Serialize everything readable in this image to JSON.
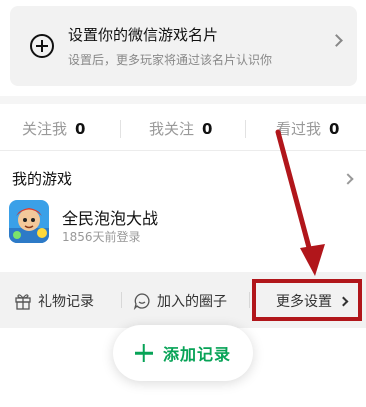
{
  "profile_card": {
    "title": "设置你的微信游戏名片",
    "subtitle": "设置后，更多玩家将通过该名片认识你"
  },
  "stats": [
    {
      "label": "关注我",
      "value": "0"
    },
    {
      "label": "我关注",
      "value": "0"
    },
    {
      "label": "看过我",
      "value": "0"
    }
  ],
  "games": {
    "title": "我的游戏",
    "items": [
      {
        "name": "全民泡泡大战",
        "last_login": "1856天前登录"
      }
    ]
  },
  "bottom_bar": {
    "gift_record": "礼物记录",
    "joined_circles": "加入的圈子",
    "more_settings": "更多设置"
  },
  "add_record": {
    "label": "添加记录"
  },
  "colors": {
    "accent": "#07a357",
    "annotation": "#b1161b"
  }
}
